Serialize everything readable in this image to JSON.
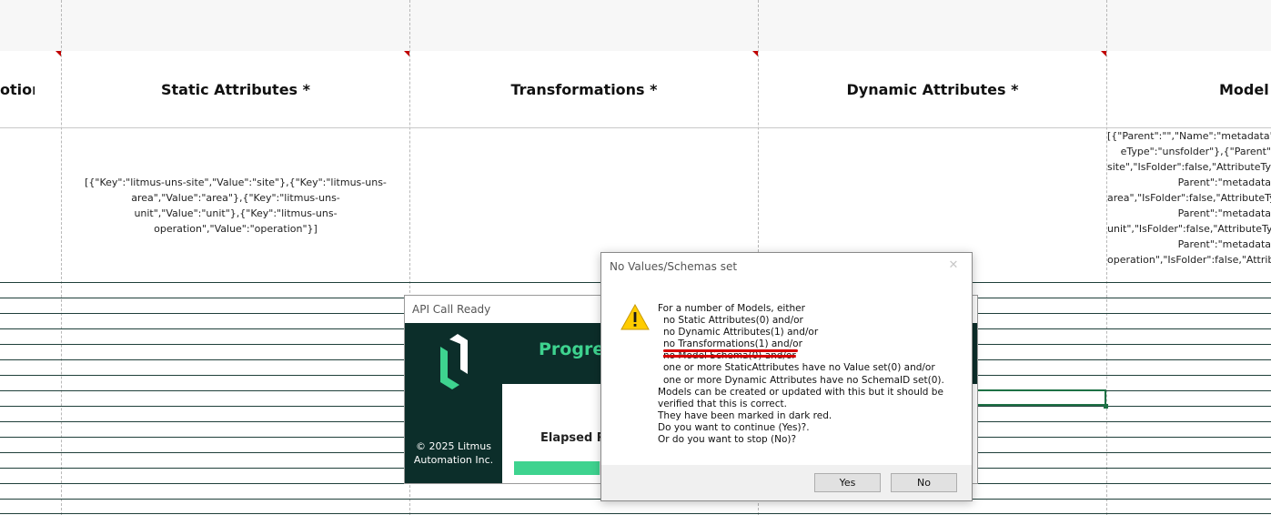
{
  "sheet": {
    "headers": [
      {
        "label": "otion"
      },
      {
        "label": "Static Attributes *"
      },
      {
        "label": "Transformations *"
      },
      {
        "label": "Dynamic Attributes *"
      },
      {
        "label": "Model"
      }
    ],
    "static_attributes_cell": [
      "[{\"Key\":\"litmus-uns-site\",\"Value\":\"site\"},{\"Key\":\"litmus-uns-",
      "area\",\"Value\":\"area\"},{\"Key\":\"litmus-uns-",
      "unit\",\"Value\":\"unit\"},{\"Key\":\"litmus-uns-",
      "operation\",\"Value\":\"operation\"}]"
    ],
    "model_cell": [
      "[{\"Parent\":\"\",\"Name\":\"metadata\",\"",
      "eType\":\"unsfolder\"},{\"Parent\"",
      "site\",\"IsFolder\":false,\"AttributeTyp",
      "Parent\":\"metadata",
      "area\",\"IsFolder\":false,\"AttributeTy",
      "Parent\":\"metadata",
      "unit\",\"IsFolder\":false,\"AttributeTy",
      "Parent\":\"metadata",
      "operation\",\"IsFolder\":false,\"Attrib"
    ],
    "accent_color": "#c00000"
  },
  "api_window": {
    "title": "API Call Ready",
    "progress_title": "Progres",
    "copyright_line1": "© 2025 Litmus",
    "copyright_line2": "Automation Inc.",
    "elapsed_label": "Elapsed Ru",
    "progress_fraction": 0.19,
    "brand_color": "#3ed38f",
    "bg_color": "#0c2e2a"
  },
  "dialog": {
    "title": "No Values/Schemas set",
    "close_glyph": "✕",
    "icon": "warning-icon",
    "lines": {
      "l1": "For a number of Models, either",
      "l2": "no Static Attributes(0) and/or",
      "l3": "no Dynamic Attributes(1) and/or",
      "l4": "no Transformations(1) and/or",
      "l5": "no Model Schema(0) and/or",
      "l6": "one or more StaticAttributes have no Value set(0) and/or",
      "l7": "one or more Dynamic Attributes have no SchemaID set(0).",
      "l8": "Models can be created or updated with this but it should be",
      "l9": "verified that this is correct.",
      "l10": "They have been marked in dark red.",
      "l11": "Do you want to continue (Yes)?.",
      "l12": "Or do you want to stop (No)?"
    },
    "yes_label": "Yes",
    "no_label": "No"
  }
}
